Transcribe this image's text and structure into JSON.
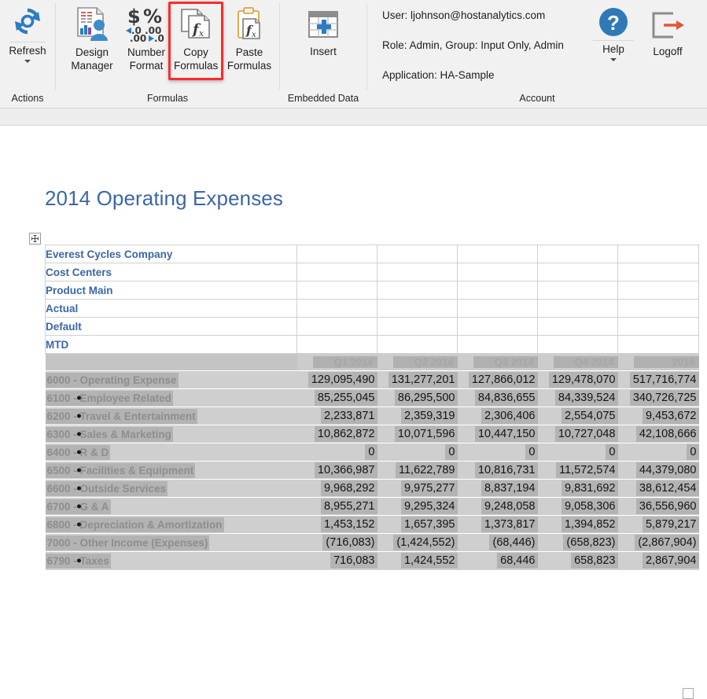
{
  "ribbon": {
    "groups": [
      {
        "name": "actions",
        "label": "Actions"
      },
      {
        "name": "formulas",
        "label": "Formulas"
      },
      {
        "name": "embedded-data",
        "label": "Embedded Data"
      },
      {
        "name": "account",
        "label": "Account"
      }
    ],
    "controls": {
      "refresh": {
        "label": "Refresh",
        "icon": "refresh-icon",
        "has_dropdown": true
      },
      "design_manager": {
        "line1": "Design",
        "line2": "Manager",
        "icon": "design-manager-icon"
      },
      "number_format": {
        "line1": "Number",
        "line2": "Format",
        "icon": "number-format-icon"
      },
      "copy_formulas": {
        "line1": "Copy",
        "line2": "Formulas",
        "icon": "copy-formulas-icon",
        "highlighted": true
      },
      "paste_formulas": {
        "line1": "Paste",
        "line2": "Formulas",
        "icon": "paste-formulas-icon"
      },
      "insert": {
        "label": "Insert",
        "icon": "insert-table-icon"
      },
      "help": {
        "label": "Help",
        "icon": "help-icon",
        "has_dropdown": true
      },
      "logoff": {
        "label": "Logoff",
        "icon": "logoff-icon"
      }
    },
    "account": {
      "user": "User: ljohnson@hostanalytics.com",
      "role": "Role: Admin, Group: Input Only, Admin",
      "application": "Application: HA-Sample"
    }
  },
  "highlight_color": "#ff2a2a",
  "sheet": {
    "title": "2014 Operating Expenses",
    "pov_rows": [
      "Everest Cycles Company",
      "Cost Centers",
      "Product Main",
      "Actual",
      "Default",
      "MTD"
    ],
    "column_headers": [
      "Q1 2014",
      "Q2 2014",
      "Q3 2014",
      "Q4 2014",
      "2014"
    ],
    "rows": [
      {
        "label": "6000 - Operating Expense",
        "indent": 0,
        "bullet": false,
        "values": [
          "129,095,490",
          "131,277,201",
          "127,866,012",
          "129,478,070",
          "517,716,774"
        ]
      },
      {
        "label": "6100 - Employee Related",
        "indent": 1,
        "bullet": true,
        "values": [
          "85,255,045",
          "86,295,500",
          "84,836,655",
          "84,339,524",
          "340,726,725"
        ]
      },
      {
        "label": "6200 - Travel & Entertainment",
        "indent": 1,
        "bullet": true,
        "values": [
          "2,233,871",
          "2,359,319",
          "2,306,406",
          "2,554,075",
          "9,453,672"
        ]
      },
      {
        "label": "6300 - Sales & Marketing",
        "indent": 1,
        "bullet": true,
        "values": [
          "10,862,872",
          "10,071,596",
          "10,447,150",
          "10,727,048",
          "42,108,666"
        ]
      },
      {
        "label": "6400 - R & D",
        "indent": 1,
        "bullet": true,
        "values": [
          "0",
          "0",
          "0",
          "0",
          "0"
        ]
      },
      {
        "label": "6500 - Facilities & Equipment",
        "indent": 1,
        "bullet": true,
        "values": [
          "10,366,987",
          "11,622,789",
          "10,816,731",
          "11,572,574",
          "44,379,080"
        ]
      },
      {
        "label": "6600 - Outside Services",
        "indent": 1,
        "bullet": true,
        "values": [
          "9,968,292",
          "9,975,277",
          "8,837,194",
          "9,831,692",
          "38,612,454"
        ]
      },
      {
        "label": "6700 - G & A",
        "indent": 1,
        "bullet": true,
        "values": [
          "8,955,271",
          "9,295,324",
          "9,248,058",
          "9,058,306",
          "36,556,960"
        ]
      },
      {
        "label": "6800 - Depreciation & Amortization",
        "indent": 1,
        "bullet": true,
        "values": [
          "1,453,152",
          "1,657,395",
          "1,373,817",
          "1,394,852",
          "5,879,217"
        ]
      },
      {
        "label": "7000 - Other Income (Expenses)",
        "indent": 0,
        "bullet": false,
        "values": [
          "(716,083)",
          "(1,424,552)",
          "(68,446)",
          "(658,823)",
          "(2,867,904)"
        ]
      },
      {
        "label": "6790 - Taxes",
        "indent": 1,
        "bullet": true,
        "values": [
          "716,083",
          "1,424,552",
          "68,446",
          "658,823",
          "2,867,904"
        ]
      }
    ]
  },
  "chart_data": {
    "type": "table",
    "title": "2014 Operating Expenses",
    "categories": [
      "Q1 2014",
      "Q2 2014",
      "Q3 2014",
      "Q4 2014",
      "2014"
    ],
    "series": [
      {
        "name": "6000 - Operating Expense",
        "values": [
          129095490,
          131277201,
          127866012,
          129478070,
          517716774
        ]
      },
      {
        "name": "6100 - Employee Related",
        "values": [
          85255045,
          86295500,
          84836655,
          84339524,
          340726725
        ]
      },
      {
        "name": "6200 - Travel & Entertainment",
        "values": [
          2233871,
          2359319,
          2306406,
          2554075,
          9453672
        ]
      },
      {
        "name": "6300 - Sales & Marketing",
        "values": [
          10862872,
          10071596,
          10447150,
          10727048,
          42108666
        ]
      },
      {
        "name": "6400 - R & D",
        "values": [
          0,
          0,
          0,
          0,
          0
        ]
      },
      {
        "name": "6500 - Facilities & Equipment",
        "values": [
          10366987,
          11622789,
          10816731,
          11572574,
          44379080
        ]
      },
      {
        "name": "6600 - Outside Services",
        "values": [
          9968292,
          9975277,
          8837194,
          9831692,
          38612454
        ]
      },
      {
        "name": "6700 - G & A",
        "values": [
          8955271,
          9295324,
          9248058,
          9058306,
          36556960
        ]
      },
      {
        "name": "6800 - Depreciation & Amortization",
        "values": [
          1453152,
          1657395,
          1373817,
          1394852,
          5879217
        ]
      },
      {
        "name": "7000 - Other Income (Expenses)",
        "values": [
          -716083,
          -1424552,
          -68446,
          -658823,
          -2867904
        ]
      },
      {
        "name": "6790 - Taxes",
        "values": [
          716083,
          1424552,
          68446,
          658823,
          2867904
        ]
      }
    ],
    "xlabel": "",
    "ylabel": ""
  }
}
